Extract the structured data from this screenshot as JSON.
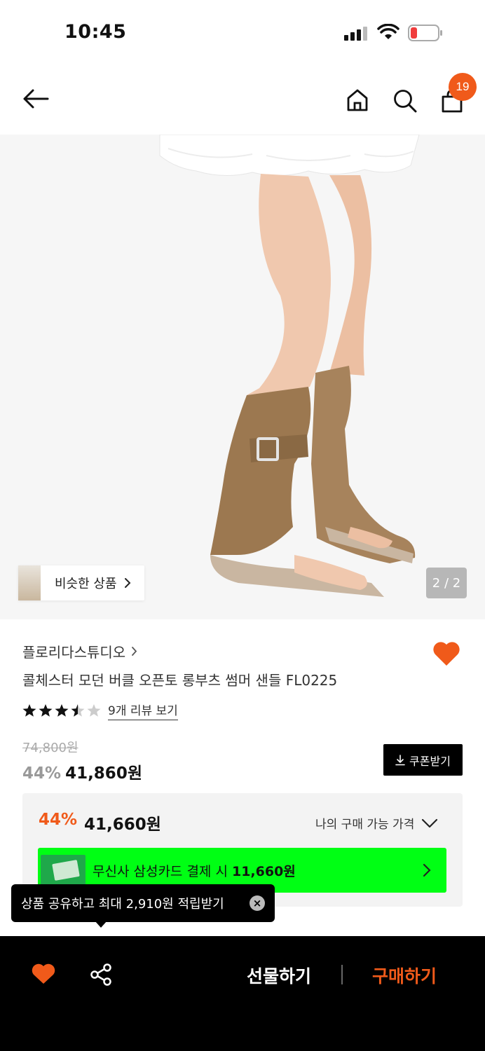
{
  "status_bar": {
    "time": "10:45"
  },
  "nav": {
    "cart_count": "19"
  },
  "image": {
    "page_indicator": "2 / 2",
    "similar_label": "비슷한 상품"
  },
  "product": {
    "brand": "플로리다스튜디오",
    "title": "콜체스터 모던 버클 오픈토 롱부츠 썸머 샌들 FL0225",
    "rating": 3.5,
    "review_link": "9개 리뷰 보기",
    "original_price": "74,800원",
    "sale_rate": "44%",
    "sale_price": "41,860원",
    "coupon_label": "쿠폰받기"
  },
  "benefit": {
    "rate": "44%",
    "price": "41,660원",
    "my_price_label": "나의 구매 가능 가격",
    "card_text_prefix": "무신사 삼성카드 결제 시 ",
    "card_text_price": "11,660원"
  },
  "tooltip": {
    "text": "상품 공유하고 최대 2,910원 적립받기"
  },
  "bottom_bar": {
    "gift_label": "선물하기",
    "buy_label": "구매하기"
  },
  "colors": {
    "accent": "#f05a1a",
    "card_banner": "#00ff14",
    "bar": "#000000"
  }
}
